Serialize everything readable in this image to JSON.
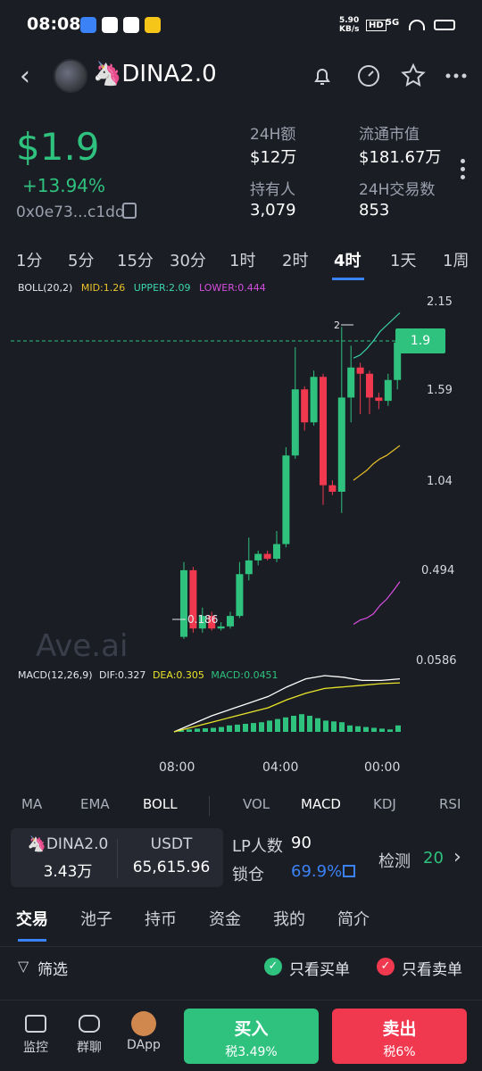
{
  "status": {
    "time": "08:08",
    "net": "5.90\nKB/s",
    "hd": "HD",
    "sig": "5G"
  },
  "token": {
    "name": "🦄DINA2.0",
    "price": "$1.9",
    "change": "+13.94%",
    "address": "0x0e73...c1dd"
  },
  "stats": [
    {
      "label": "24H额",
      "value": "$12万"
    },
    {
      "label": "流通市值",
      "value": "$181.67万"
    },
    {
      "label": "持有人",
      "value": "3,079"
    },
    {
      "label": "24H交易数",
      "value": "853"
    }
  ],
  "timeframes": [
    "1分",
    "5分",
    "15分",
    "30分",
    "1时",
    "2时",
    "4时",
    "1天",
    "1周"
  ],
  "active_timeframe": "4时",
  "chart": {
    "boll_label": "BOLL(20,2)",
    "mid": "MID:1.26",
    "upper": "UPPER:2.09",
    "lower": "LOWER:0.444",
    "y_labels": [
      "2.15",
      "1.59",
      "1.04",
      "0.494",
      "0.0586"
    ],
    "price_tag": "1.9",
    "high_label": "2",
    "low_label": "0.186",
    "watermark": "Ave.ai",
    "macd_label": "MACD(12,26,9)",
    "dif": "DIF:0.327",
    "dea": "DEA:0.305",
    "macd": "MACD:0.0451",
    "x_labels": [
      "08:00",
      "04:00",
      "00:00"
    ],
    "colors": {
      "up": "#2ec27e",
      "down": "#f0384f",
      "mid": "#e8c12a",
      "upper": "#3ad6b0",
      "lower": "#d64ee0",
      "dif": "#ffffff",
      "dea": "#e8e52a"
    }
  },
  "chart_data": {
    "type": "candlestick",
    "y_range": [
      0.0586,
      2.15
    ],
    "candles": [
      {
        "o": 0.18,
        "c": 0.5,
        "h": 0.55,
        "l": 0.17
      },
      {
        "o": 0.5,
        "c": 0.22,
        "h": 0.52,
        "l": 0.2
      },
      {
        "o": 0.22,
        "c": 0.28,
        "h": 0.32,
        "l": 0.2
      },
      {
        "o": 0.28,
        "c": 0.22,
        "h": 0.3,
        "l": 0.21
      },
      {
        "o": 0.22,
        "c": 0.23,
        "h": 0.25,
        "l": 0.21
      },
      {
        "o": 0.23,
        "c": 0.28,
        "h": 0.3,
        "l": 0.22
      },
      {
        "o": 0.28,
        "c": 0.48,
        "h": 0.55,
        "l": 0.27
      },
      {
        "o": 0.48,
        "c": 0.56,
        "h": 0.7,
        "l": 0.45
      },
      {
        "o": 0.56,
        "c": 0.6,
        "h": 0.62,
        "l": 0.53
      },
      {
        "o": 0.6,
        "c": 0.57,
        "h": 0.62,
        "l": 0.56
      },
      {
        "o": 0.57,
        "c": 0.66,
        "h": 0.74,
        "l": 0.55
      },
      {
        "o": 0.66,
        "c": 1.2,
        "h": 1.25,
        "l": 0.64
      },
      {
        "o": 1.2,
        "c": 1.6,
        "h": 1.87,
        "l": 1.18
      },
      {
        "o": 1.6,
        "c": 1.4,
        "h": 1.62,
        "l": 1.35
      },
      {
        "o": 1.4,
        "c": 1.68,
        "h": 1.72,
        "l": 1.38
      },
      {
        "o": 1.68,
        "c": 1.02,
        "h": 1.7,
        "l": 0.9
      },
      {
        "o": 1.02,
        "c": 0.98,
        "h": 1.05,
        "l": 0.96
      },
      {
        "o": 0.98,
        "c": 1.55,
        "h": 2.0,
        "l": 0.85
      },
      {
        "o": 1.55,
        "c": 1.74,
        "h": 1.88,
        "l": 1.4
      },
      {
        "o": 1.74,
        "c": 1.7,
        "h": 1.77,
        "l": 1.45
      },
      {
        "o": 1.7,
        "c": 1.55,
        "h": 1.72,
        "l": 1.45
      },
      {
        "o": 1.55,
        "c": 1.53,
        "h": 1.58,
        "l": 1.48
      },
      {
        "o": 1.53,
        "c": 1.66,
        "h": 1.7,
        "l": 1.5
      },
      {
        "o": 1.66,
        "c": 1.9,
        "h": 1.92,
        "l": 1.6
      }
    ],
    "upper_band": [
      1.8,
      1.82,
      1.86,
      1.91,
      1.97,
      2.01,
      2.05,
      2.09
    ],
    "mid_band": [
      1.05,
      1.08,
      1.11,
      1.15,
      1.18,
      1.2,
      1.23,
      1.26
    ],
    "lower_band": [
      0.24,
      0.26,
      0.27,
      0.29,
      0.33,
      0.36,
      0.4,
      0.444
    ],
    "macd_hist": [
      0.01,
      0.015,
      0.02,
      0.022,
      0.025,
      0.03,
      0.04,
      0.045,
      0.05,
      0.055,
      0.06,
      0.07,
      0.08,
      0.09,
      0.1,
      0.11,
      0.1,
      0.085,
      0.07,
      0.065,
      0.06,
      0.04,
      0.035,
      0.03,
      0.025,
      0.02,
      0.015,
      0.04
    ],
    "dif": [
      0.0,
      0.05,
      0.1,
      0.14,
      0.18,
      0.22,
      0.28,
      0.33,
      0.35,
      0.34,
      0.32,
      0.32,
      0.33
    ],
    "dea": [
      0.0,
      0.03,
      0.06,
      0.09,
      0.12,
      0.15,
      0.2,
      0.24,
      0.27,
      0.28,
      0.29,
      0.3,
      0.305
    ]
  },
  "indicator_tabs": [
    "MA",
    "EMA",
    "BOLL",
    "VOL",
    "MACD",
    "KDJ",
    "RSI"
  ],
  "pair": {
    "token": "🦄DINA2.0",
    "token_amount": "3.43万",
    "quote": "USDT",
    "quote_amount": "65,615.96"
  },
  "lp": {
    "label": "LP人数",
    "count": "90",
    "lock_label": "锁仓",
    "lock_pct": "69.9%",
    "check_label": "检测",
    "check_value": "20"
  },
  "main_tabs": [
    "交易",
    "池子",
    "持币",
    "资金",
    "我的",
    "简介"
  ],
  "filter": {
    "label": "筛选",
    "buy_only": "只看买单",
    "sell_only": "只看卖单"
  },
  "bottom_nav": [
    {
      "label": "监控"
    },
    {
      "label": "群聊"
    },
    {
      "label": "DApp"
    }
  ],
  "buy": {
    "label": "买入",
    "tax": "税3.49%"
  },
  "sell": {
    "label": "卖出",
    "tax": "税6%"
  }
}
